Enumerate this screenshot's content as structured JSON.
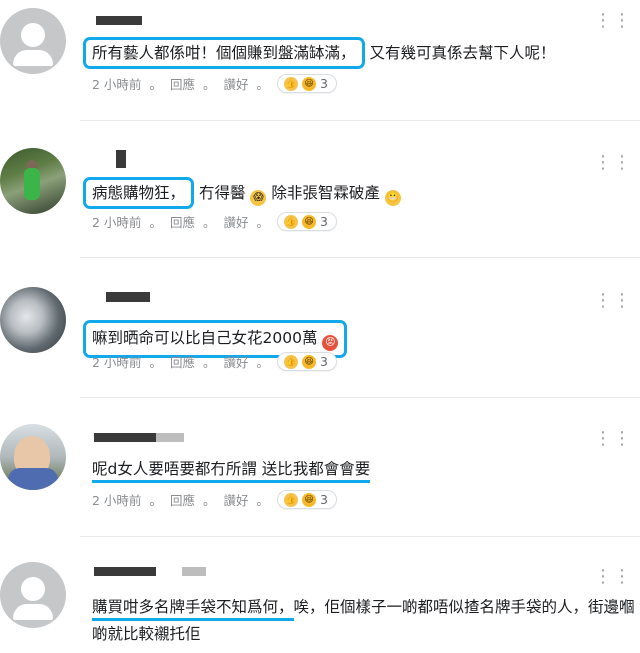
{
  "comments": [
    {
      "highlight_text": "所有藝人都係咁！個個賺到盤滿缽滿，",
      "rest_text": "又有幾可真係去幫下人呢！",
      "time": "2 小時前",
      "reply": "回應",
      "like": "讚好",
      "reaction_count": "3"
    },
    {
      "highlight_text": "病態購物狂，",
      "rest_text_a": "冇得醫",
      "rest_text_b": "除非張智霖破產",
      "time": "2 小時前",
      "reply": "回應",
      "like": "讚好",
      "reaction_count": "3"
    },
    {
      "highlight_text": "嘛到晒命可以比自己女花2000萬",
      "time": "2 小時前",
      "reply": "回應",
      "like": "讚好",
      "reaction_count": "3"
    },
    {
      "highlight_text": "呢d女人要唔要都冇所謂 送比我都會會要",
      "time": "2 小時前",
      "reply": "回應",
      "like": "讚好",
      "reaction_count": "3"
    },
    {
      "highlight_text": "購買咁多名牌手袋不知爲何，",
      "rest_text": "唉，佢個樣子一啲都唔似揸名牌手袋的人，街邊嗰啲就比較襯托佢"
    }
  ],
  "icons": {
    "more": "more-horizontal-icon",
    "reaction_like": "thumbs-up-icon",
    "reaction_emoji": "emoji-icon"
  },
  "colors": {
    "highlight": "#12a8ec",
    "meta": "#8a8d91"
  }
}
